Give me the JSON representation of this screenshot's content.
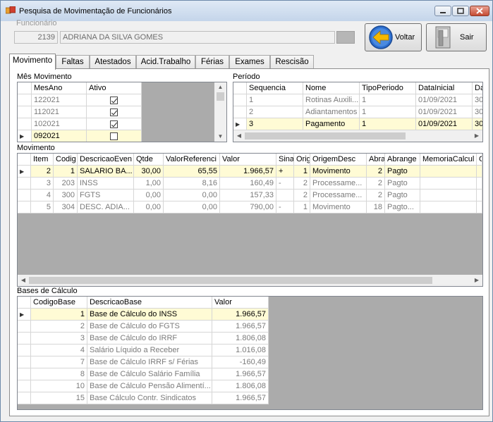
{
  "window": {
    "title": "Pesquisa de Movimentação de Funcionários"
  },
  "funcionario": {
    "label": "Funcionário",
    "code": "2139",
    "name": "ADRIANA DA SILVA GOMES"
  },
  "buttons": {
    "voltar": "Voltar",
    "sair": "Sair"
  },
  "tabs": [
    "Movimento",
    "Faltas",
    "Atestados",
    "Acid.Trabalho",
    "Férias",
    "Exames",
    "Rescisão"
  ],
  "mes_movimento": {
    "label": "Mês Movimento",
    "headers": [
      "MesAno",
      "Ativo"
    ],
    "rows": [
      {
        "mesano": "122021",
        "ativo": true
      },
      {
        "mesano": "112021",
        "ativo": true
      },
      {
        "mesano": "102021",
        "ativo": true
      },
      {
        "mesano": "092021",
        "ativo": false
      }
    ]
  },
  "periodo": {
    "label": "Período",
    "headers": [
      "Sequencia",
      "Nome",
      "TipoPeriodo",
      "DataInicial",
      "Da"
    ],
    "rows": [
      [
        "1",
        "Rotinas Auxili...",
        "1",
        "01/09/2021",
        "30/0"
      ],
      [
        "2",
        "Adiantamentos",
        "1",
        "01/09/2021",
        "30/0"
      ],
      [
        "3",
        "Pagamento",
        "1",
        "01/09/2021",
        "30/0"
      ]
    ]
  },
  "movimento": {
    "label": "Movimento",
    "headers": [
      "Item",
      "Codig",
      "DescricaoEven",
      "Qtde",
      "ValorReferenci",
      "Valor",
      "Sina",
      "Orig",
      "OrigemDesc",
      "Abra",
      "Abrange",
      "MemoriaCalcul",
      "O"
    ],
    "rows": [
      [
        "2",
        "1",
        "SALARIO BA...",
        "30,00",
        "65,55",
        "1.966,57",
        "+",
        "1",
        "Movimento",
        "2",
        "Pagto",
        "",
        ""
      ],
      [
        "3",
        "203",
        "INSS",
        "1,00",
        "8,16",
        "160,49",
        "-",
        "2",
        "Processame...",
        "2",
        "Pagto",
        "",
        ""
      ],
      [
        "4",
        "300",
        "FGTS",
        "0,00",
        "0,00",
        "157,33",
        "",
        "2",
        "Processame...",
        "2",
        "Pagto",
        "",
        ""
      ],
      [
        "5",
        "304",
        "DESC. ADIA...",
        "0,00",
        "0,00",
        "790,00",
        "-",
        "1",
        "Movimento",
        "18",
        "Pagto...",
        "",
        ""
      ]
    ]
  },
  "bases": {
    "label": "Bases de Cálculo",
    "headers": [
      "CodigoBase",
      "DescricaoBase",
      "Valor"
    ],
    "rows": [
      [
        "1",
        "Base de Cálculo do INSS",
        "1.966,57"
      ],
      [
        "2",
        "Base de Cálculo do FGTS",
        "1.966,57"
      ],
      [
        "3",
        "Base de Cálculo do IRRF",
        "1.806,08"
      ],
      [
        "4",
        "Salário Líquido a Receber",
        "1.016,08"
      ],
      [
        "7",
        "Base de Cálculo IRRF s/ Férias",
        "-160,49"
      ],
      [
        "8",
        "Base de Cálculo Salário Família",
        "1.966,57"
      ],
      [
        "10",
        "Base de Cálculo Pensão Alimentí...",
        "1.806,08"
      ],
      [
        "15",
        "Base Cálculo Contr. Sindicatos",
        "1.966,57"
      ]
    ]
  },
  "colors": {
    "selected_row": "#fffbd5",
    "grid_empty": "#ababab",
    "accent_arrow": "#f5b800"
  }
}
